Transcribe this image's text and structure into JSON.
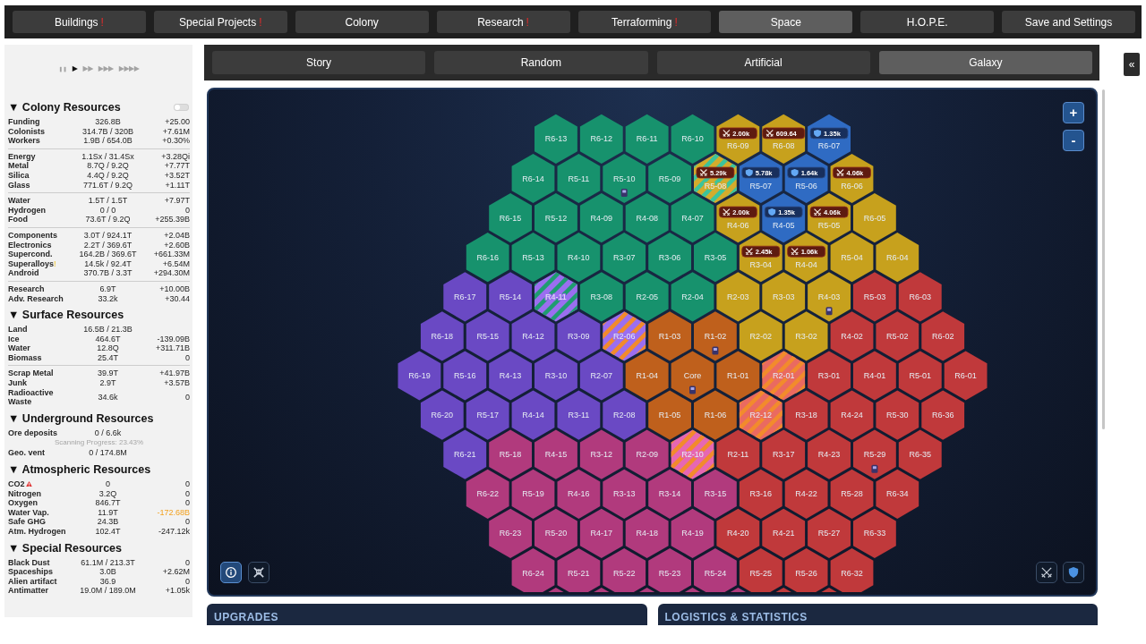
{
  "top_tabs": [
    {
      "label": "Buildings",
      "alert": "!",
      "selected": false
    },
    {
      "label": "Special Projects",
      "alert": "!",
      "selected": false
    },
    {
      "label": "Colony",
      "selected": false
    },
    {
      "label": "Research",
      "alert": "!",
      "selected": false
    },
    {
      "label": "Terraforming",
      "alert": "!",
      "selected": false
    },
    {
      "label": "Space",
      "selected": true
    },
    {
      "label": "H.O.P.E.",
      "selected": false
    },
    {
      "label": "Save and Settings",
      "selected": false
    }
  ],
  "sidebar": {
    "speed_controls": [
      {
        "symbol": "❚❚",
        "selected": false
      },
      {
        "symbol": "▶",
        "selected": true
      },
      {
        "symbol": "▶▶",
        "selected": false
      },
      {
        "symbol": "▶▶▶",
        "selected": false
      },
      {
        "symbol": "▶▶▶▶",
        "selected": false
      }
    ],
    "sections": [
      {
        "marker": "▼",
        "title": "Colony Resources",
        "expanded": true,
        "toggle": {
          "on": false
        },
        "groups": [
          {
            "rows": [
              {
                "name": "Funding",
                "amount": "326.8B",
                "rate": "+25.00",
                "warning": false
              },
              {
                "name": "Colonists",
                "amount": "314.7B / 320B",
                "rate": "+7.61M",
                "warning": false
              },
              {
                "name": "Workers",
                "amount": "1.9B / 654.0B",
                "rate": "+0.30%",
                "warning": false
              }
            ]
          },
          {
            "rows": [
              {
                "name": "Energy",
                "amount": "1.1Sx / 31.4Sx",
                "rate": "+3.28Qi",
                "warning": false
              },
              {
                "name": "Metal",
                "amount": "8.7Q / 9.2Q",
                "rate": "+7.77T",
                "warning": false
              },
              {
                "name": "Silica",
                "amount": "4.4Q / 9.2Q",
                "rate": "+3.52T",
                "warning": false
              },
              {
                "name": "Glass",
                "amount": "771.6T / 9.2Q",
                "rate": "+1.11T",
                "warning": false
              }
            ]
          },
          {
            "rows": [
              {
                "name": "Water",
                "amount": "1.5T / 1.5T",
                "rate": "+7.97T",
                "warning": false
              },
              {
                "name": "Hydrogen",
                "amount": "0 / 0",
                "rate": "0",
                "warning": false
              },
              {
                "name": "Food",
                "amount": "73.6T / 9.2Q",
                "rate": "+255.39B",
                "warning": false
              }
            ]
          },
          {
            "rows": [
              {
                "name": "Components",
                "amount": "3.0T / 924.1T",
                "rate": "+2.04B",
                "warning": false
              },
              {
                "name": "Electronics",
                "amount": "2.2T / 369.6T",
                "rate": "+2.60B",
                "warning": false
              },
              {
                "name": "Supercond.",
                "amount": "164.2B / 369.6T",
                "rate": "+661.33M",
                "warning": false
              },
              {
                "name": "Superalloys",
                "alert": "!",
                "amount": "14.5k / 92.4T",
                "rate": "+6.54M",
                "warning": false
              },
              {
                "name": "Android",
                "amount": "370.7B / 3.3T",
                "rate": "+294.30M",
                "warning": false
              }
            ]
          },
          {
            "rows": [
              {
                "name": "Research",
                "amount": "6.9T",
                "rate": "+10.00B",
                "warning": false
              },
              {
                "name": "Adv. Research",
                "amount": "33.2k",
                "rate": "+30.44",
                "warning": false
              }
            ]
          }
        ]
      },
      {
        "marker": "▼",
        "title": "Surface Resources",
        "expanded": true,
        "groups": [
          {
            "rows": [
              {
                "name": "Land",
                "amount": "16.5B / 21.3B",
                "warning": false
              },
              {
                "name": "Ice",
                "amount": "464.6T",
                "rate": "-139.09B",
                "warning": false
              },
              {
                "name": "Water",
                "amount": "12.8Q",
                "rate": "+311.71B",
                "warning": false
              },
              {
                "name": "Biomass",
                "amount": "25.4T",
                "rate": "0",
                "warning": false
              }
            ]
          },
          {
            "rows": [
              {
                "name": "Scrap Metal",
                "amount": "39.9T",
                "rate": "+41.97B",
                "warning": false
              },
              {
                "name": "Junk",
                "amount": "2.9T",
                "rate": "+3.57B",
                "warning": false
              },
              {
                "name": "Radioactive Waste",
                "amount": "34.6k",
                "rate": "0",
                "warning": false
              }
            ]
          }
        ]
      },
      {
        "marker": "▼",
        "title": "Underground Resources",
        "expanded": true,
        "groups": [
          {
            "rows": [
              {
                "name": "Ore deposits",
                "amount": "0 / 6.6k",
                "note": "Scanning Progress: 23.43%",
                "warning": false
              },
              {
                "name": "Geo. vent",
                "amount": "0 / 174.8M",
                "warning": false
              }
            ]
          }
        ]
      },
      {
        "marker": "▼",
        "title": "Atmospheric Resources",
        "expanded": true,
        "groups": [
          {
            "rows": [
              {
                "name": "CO2",
                "amount": "0",
                "rate": "0",
                "warning": true
              },
              {
                "name": "Nitrogen",
                "amount": "3.2Q",
                "rate": "0",
                "warning": false
              },
              {
                "name": "Oxygen",
                "amount": "846.7T",
                "rate": "0",
                "warning": false
              },
              {
                "name": "Water Vap.",
                "amount": "11.9T",
                "rate": "-172.68B",
                "warning": false,
                "rate_warning": true
              },
              {
                "name": "Safe GHG",
                "amount": "24.3B",
                "rate": "0",
                "warning": false
              },
              {
                "name": "Atm. Hydrogen",
                "amount": "102.4T",
                "rate": "-247.12k",
                "warning": false
              }
            ]
          }
        ]
      },
      {
        "marker": "▼",
        "title": "Special Resources",
        "expanded": true,
        "groups": [
          {
            "rows": [
              {
                "name": "Black Dust",
                "amount": "61.1M / 213.3T",
                "rate": "0",
                "warning": false
              },
              {
                "name": "Spaceships",
                "amount": "3.0B",
                "rate": "+2.62M",
                "warning": false
              },
              {
                "name": "Alien artifact",
                "amount": "36.9",
                "rate": "0",
                "warning": false
              },
              {
                "name": "Antimatter",
                "amount": "19.0M / 189.0M",
                "rate": "+1.05k",
                "warning": false
              }
            ]
          }
        ]
      }
    ]
  },
  "sub_tabs": [
    {
      "label": "Story",
      "selected": false
    },
    {
      "label": "Random",
      "selected": false
    },
    {
      "label": "Artificial",
      "selected": false
    },
    {
      "label": "Galaxy",
      "selected": true
    }
  ],
  "galaxy_map": {
    "rows": [
      {
        "cells": [
          {
            "label": "R6-13",
            "color": "#17926d",
            "unit": false
          },
          {
            "label": "R6-12",
            "color": "#17926d",
            "unit": false
          },
          {
            "label": "R6-11",
            "color": "#17926d",
            "unit": false
          },
          {
            "label": "R6-10",
            "color": "#17926d",
            "unit": false
          },
          {
            "label": "R6-09",
            "color": "#c7a11d",
            "unit": false,
            "badge": {
              "kind": "attack",
              "value": "2.00k"
            }
          },
          {
            "label": "R6-08",
            "color": "#c7a11d",
            "unit": false,
            "badge": {
              "kind": "attack",
              "value": "609.64"
            }
          },
          {
            "label": "R6-07",
            "color": "#2f6bc3",
            "unit": false,
            "badge": {
              "kind": "defense",
              "value": "1.35k"
            }
          }
        ]
      },
      {
        "cells": [
          {
            "label": "R6-14",
            "color": "#17926d",
            "unit": false
          },
          {
            "label": "R5-11",
            "color": "#17926d",
            "unit": false
          },
          {
            "label": "R5-10",
            "color": "#17926d",
            "unit": true
          },
          {
            "label": "R5-09",
            "color": "#17926d",
            "unit": false
          },
          {
            "label": "R5-08",
            "color": "#d4ac2c",
            "stripes": {
              "color": "#3cc49c"
            },
            "unit": false,
            "badge": {
              "kind": "attack",
              "value": "5.29k"
            }
          },
          {
            "label": "R5-07",
            "color": "#2f6bc3",
            "unit": false,
            "badge": {
              "kind": "defense",
              "value": "5.78k"
            }
          },
          {
            "label": "R5-06",
            "color": "#2f6bc3",
            "unit": false,
            "badge": {
              "kind": "defense",
              "value": "1.64k"
            }
          },
          {
            "label": "R6-06",
            "color": "#c7a11d",
            "unit": false,
            "badge": {
              "kind": "attack",
              "value": "4.06k"
            }
          }
        ]
      },
      {
        "cells": [
          {
            "label": "R6-15",
            "color": "#17926d",
            "unit": false
          },
          {
            "label": "R5-12",
            "color": "#17926d",
            "unit": false
          },
          {
            "label": "R4-09",
            "color": "#17926d",
            "unit": false
          },
          {
            "label": "R4-08",
            "color": "#17926d",
            "unit": false
          },
          {
            "label": "R4-07",
            "color": "#17926d",
            "unit": false
          },
          {
            "label": "R4-06",
            "color": "#c7a11d",
            "unit": false,
            "badge": {
              "kind": "attack",
              "value": "2.00k"
            }
          },
          {
            "label": "R4-05",
            "color": "#2f6bc3",
            "unit": false,
            "badge": {
              "kind": "defense",
              "value": "1.35k"
            }
          },
          {
            "label": "R5-05",
            "color": "#c7a11d",
            "unit": false,
            "badge": {
              "kind": "attack",
              "value": "4.06k"
            }
          },
          {
            "label": "R6-05",
            "color": "#c7a11d",
            "unit": false
          }
        ]
      },
      {
        "cells": [
          {
            "label": "R6-16",
            "color": "#17926d",
            "unit": false
          },
          {
            "label": "R5-13",
            "color": "#17926d",
            "unit": false
          },
          {
            "label": "R4-10",
            "color": "#17926d",
            "unit": false
          },
          {
            "label": "R3-07",
            "color": "#17926d",
            "unit": false
          },
          {
            "label": "R3-06",
            "color": "#17926d",
            "unit": false
          },
          {
            "label": "R3-05",
            "color": "#17926d",
            "unit": false
          },
          {
            "label": "R3-04",
            "color": "#c7a11d",
            "unit": false,
            "badge": {
              "kind": "attack",
              "value": "2.45k"
            }
          },
          {
            "label": "R4-04",
            "color": "#c7a11d",
            "unit": false,
            "badge": {
              "kind": "attack",
              "value": "1.06k"
            }
          },
          {
            "label": "R5-04",
            "color": "#c7a11d",
            "unit": false
          },
          {
            "label": "R6-04",
            "color": "#c7a11d",
            "unit": false
          }
        ]
      },
      {
        "cells": [
          {
            "label": "R6-17",
            "color": "#6a49c4",
            "unit": false
          },
          {
            "label": "R5-14",
            "color": "#6a49c4",
            "unit": false
          },
          {
            "label": "R4-11",
            "color": "#9b6ef0",
            "stripes": {
              "color": "#1f9c70"
            },
            "unit": false
          },
          {
            "label": "R3-08",
            "color": "#17926d",
            "unit": false
          },
          {
            "label": "R2-05",
            "color": "#17926d",
            "unit": false
          },
          {
            "label": "R2-04",
            "color": "#17926d",
            "unit": false
          },
          {
            "label": "R2-03",
            "color": "#c7a11d",
            "unit": false
          },
          {
            "label": "R3-03",
            "color": "#c7a11d",
            "unit": false
          },
          {
            "label": "R4-03",
            "color": "#c7a11d",
            "unit": true
          },
          {
            "label": "R5-03",
            "color": "#c0393b",
            "unit": false
          },
          {
            "label": "R6-03",
            "color": "#c0393b",
            "unit": false
          }
        ]
      },
      {
        "cells": [
          {
            "label": "R6-18",
            "color": "#6a49c4",
            "unit": false
          },
          {
            "label": "R5-15",
            "color": "#6a49c4",
            "unit": false
          },
          {
            "label": "R4-12",
            "color": "#6a49c4",
            "unit": false
          },
          {
            "label": "R3-09",
            "color": "#6a49c4",
            "unit": false
          },
          {
            "label": "R2-06",
            "color": "#9b6ef0",
            "stripes": {
              "color": "#f28b2c"
            },
            "unit": false
          },
          {
            "label": "R1-03",
            "color": "#bf601c",
            "unit": false
          },
          {
            "label": "R1-02",
            "color": "#bf601c",
            "unit": true
          },
          {
            "label": "R2-02",
            "color": "#c7a11d",
            "unit": false
          },
          {
            "label": "R3-02",
            "color": "#c7a11d",
            "unit": false
          },
          {
            "label": "R4-02",
            "color": "#c0393b",
            "unit": false
          },
          {
            "label": "R5-02",
            "color": "#c0393b",
            "unit": false
          },
          {
            "label": "R6-02",
            "color": "#c0393b",
            "unit": false
          }
        ]
      },
      {
        "cells": [
          {
            "label": "R6-19",
            "color": "#6a49c4",
            "unit": false
          },
          {
            "label": "R5-16",
            "color": "#6a49c4",
            "unit": false
          },
          {
            "label": "R4-13",
            "color": "#6a49c4",
            "unit": false
          },
          {
            "label": "R3-10",
            "color": "#6a49c4",
            "unit": false
          },
          {
            "label": "R2-07",
            "color": "#6a49c4",
            "unit": false
          },
          {
            "label": "R1-04",
            "color": "#bf601c",
            "unit": false
          },
          {
            "label": "Core",
            "color": "#bf601c",
            "unit": true
          },
          {
            "label": "R1-01",
            "color": "#bf601c",
            "unit": false
          },
          {
            "label": "R2-01",
            "color": "#ea6a60",
            "stripes": {
              "color": "#f28b2c"
            },
            "unit": false
          },
          {
            "label": "R3-01",
            "color": "#c0393b",
            "unit": false
          },
          {
            "label": "R4-01",
            "color": "#c0393b",
            "unit": false
          },
          {
            "label": "R5-01",
            "color": "#c0393b",
            "unit": false
          },
          {
            "label": "R6-01",
            "color": "#c0393b",
            "unit": false
          }
        ]
      },
      {
        "cells": [
          {
            "label": "R6-20",
            "color": "#6a49c4",
            "unit": false
          },
          {
            "label": "R5-17",
            "color": "#6a49c4",
            "unit": false
          },
          {
            "label": "R4-14",
            "color": "#6a49c4",
            "unit": false
          },
          {
            "label": "R3-11",
            "color": "#6a49c4",
            "unit": false
          },
          {
            "label": "R2-08",
            "color": "#6a49c4",
            "unit": false
          },
          {
            "label": "R1-05",
            "color": "#bf601c",
            "unit": false
          },
          {
            "label": "R1-06",
            "color": "#bf601c",
            "unit": false
          },
          {
            "label": "R2-12",
            "color": "#ea6a60",
            "stripes": {
              "color": "#f28b2c"
            },
            "unit": false
          },
          {
            "label": "R3-18",
            "color": "#c0393b",
            "unit": false
          },
          {
            "label": "R4-24",
            "color": "#c0393b",
            "unit": false
          },
          {
            "label": "R5-30",
            "color": "#c0393b",
            "unit": false
          },
          {
            "label": "R6-36",
            "color": "#c0393b",
            "unit": false
          }
        ]
      },
      {
        "cells": [
          {
            "label": "R6-21",
            "color": "#6a49c4",
            "unit": false
          },
          {
            "label": "R5-18",
            "color": "#b13a7d",
            "unit": false
          },
          {
            "label": "R4-15",
            "color": "#b13a7d",
            "unit": false
          },
          {
            "label": "R3-12",
            "color": "#b13a7d",
            "unit": false
          },
          {
            "label": "R2-09",
            "color": "#b13a7d",
            "unit": false
          },
          {
            "label": "R2-10",
            "color": "#e667b3",
            "stripes": {
              "color": "#f28b2c"
            },
            "unit": false
          },
          {
            "label": "R2-11",
            "color": "#c0393b",
            "unit": false
          },
          {
            "label": "R3-17",
            "color": "#c0393b",
            "unit": false
          },
          {
            "label": "R4-23",
            "color": "#c0393b",
            "unit": false
          },
          {
            "label": "R5-29",
            "color": "#c0393b",
            "unit": true
          },
          {
            "label": "R6-35",
            "color": "#c0393b",
            "unit": false
          }
        ]
      },
      {
        "cells": [
          {
            "label": "R6-22",
            "color": "#b13a7d",
            "unit": false
          },
          {
            "label": "R5-19",
            "color": "#b13a7d",
            "unit": false
          },
          {
            "label": "R4-16",
            "color": "#b13a7d",
            "unit": false
          },
          {
            "label": "R3-13",
            "color": "#b13a7d",
            "unit": false
          },
          {
            "label": "R3-14",
            "color": "#b13a7d",
            "unit": false
          },
          {
            "label": "R3-15",
            "color": "#b13a7d",
            "unit": false
          },
          {
            "label": "R3-16",
            "color": "#c0393b",
            "unit": false
          },
          {
            "label": "R4-22",
            "color": "#c0393b",
            "unit": false
          },
          {
            "label": "R5-28",
            "color": "#c0393b",
            "unit": false
          },
          {
            "label": "R6-34",
            "color": "#c0393b",
            "unit": false
          }
        ]
      },
      {
        "cells": [
          {
            "label": "R6-23",
            "color": "#b13a7d",
            "unit": false
          },
          {
            "label": "R5-20",
            "color": "#b13a7d",
            "unit": false
          },
          {
            "label": "R4-17",
            "color": "#b13a7d",
            "unit": false
          },
          {
            "label": "R4-18",
            "color": "#b13a7d",
            "unit": false
          },
          {
            "label": "R4-19",
            "color": "#b13a7d",
            "unit": false
          },
          {
            "label": "R4-20",
            "color": "#c0393b",
            "unit": false
          },
          {
            "label": "R4-21",
            "color": "#c0393b",
            "unit": false
          },
          {
            "label": "R5-27",
            "color": "#c0393b",
            "unit": false
          },
          {
            "label": "R6-33",
            "color": "#c0393b",
            "unit": false
          }
        ]
      },
      {
        "cells": [
          {
            "label": "R6-24",
            "color": "#b13a7d",
            "unit": false
          },
          {
            "label": "R5-21",
            "color": "#b13a7d",
            "unit": false
          },
          {
            "label": "R5-22",
            "color": "#b13a7d",
            "unit": false
          },
          {
            "label": "R5-23",
            "color": "#b13a7d",
            "unit": false
          },
          {
            "label": "R5-24",
            "color": "#b13a7d",
            "unit": false
          },
          {
            "label": "R5-25",
            "color": "#c0393b",
            "unit": false
          },
          {
            "label": "R5-26",
            "color": "#c0393b",
            "unit": false
          },
          {
            "label": "R6-32",
            "color": "#c0393b",
            "unit": false
          }
        ]
      },
      {
        "cells": [
          {
            "color": "#b13a7d",
            "unit": false
          },
          {
            "color": "#b13a7d",
            "unit": false
          },
          {
            "color": "#b13a7d",
            "unit": false
          },
          {
            "color": "#b13a7d",
            "unit": false
          },
          {
            "color": "#b13a7d",
            "unit": false
          },
          {
            "color": "#c0393b",
            "unit": false
          },
          {
            "color": "#c0393b",
            "unit": false
          }
        ]
      }
    ],
    "zoom_buttons": [
      {
        "label": "+"
      },
      {
        "label": "-"
      }
    ],
    "view_buttons": [
      {
        "kind": "info",
        "selected": true
      },
      {
        "kind": "pirates",
        "selected": false
      }
    ],
    "filter_buttons": [
      {
        "kind": "attack",
        "selected": false
      },
      {
        "kind": "defense",
        "selected": false
      }
    ]
  },
  "bottom_panels": [
    {
      "title": "UPGRADES"
    },
    {
      "title": "LOGISTICS & STATISTICS"
    }
  ],
  "collapse_button": {
    "label": "«"
  }
}
